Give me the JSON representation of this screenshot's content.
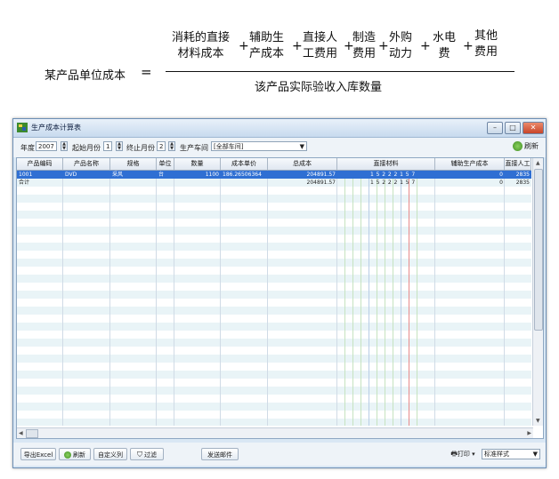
{
  "formula": {
    "lhs": "某产品单位成本",
    "equals": "=",
    "plus": "+",
    "numerator_terms": [
      {
        "line1": "消耗的直接",
        "line2": "材料成本"
      },
      {
        "line1": "辅助生",
        "line2": "产成本"
      },
      {
        "line1": "直接人",
        "line2": "工费用"
      },
      {
        "line1": "制造",
        "line2": "费用"
      },
      {
        "line1": "外购",
        "line2": "动力"
      },
      {
        "line1": "水电",
        "line2": "费"
      },
      {
        "line1": "其他",
        "line2": "费用"
      }
    ],
    "denominator": "该产品实际验收入库数量"
  },
  "window": {
    "title": "生产成本计算表",
    "controls": {
      "minimize": "–",
      "maximize": "□",
      "close": "✕"
    }
  },
  "toolbar": {
    "year_label": "年度",
    "year_value": "2007",
    "start_month_label": "起始月份",
    "start_month_value": "1",
    "end_month_label": "终止月份",
    "end_month_value": "2",
    "workshop_label": "生产车间",
    "workshop_value": "[全部车间]",
    "refresh_label": "刷新"
  },
  "grid": {
    "columns": [
      "产品编码",
      "产品名称",
      "规格",
      "单位",
      "数量",
      "成本单价",
      "总成本",
      "直接材料",
      "辅助生产成本",
      "直接人工"
    ],
    "rows": [
      {
        "selected": true,
        "cells": [
          "1001",
          "DVD",
          "采风",
          "台",
          "1100",
          "186.26506364",
          "204891.57",
          "15222157",
          "0",
          "2835"
        ]
      },
      {
        "selected": false,
        "cells": [
          "合计",
          "",
          "",
          "",
          "",
          "",
          "204891.57",
          "15222157",
          "0",
          "2835"
        ]
      }
    ]
  },
  "bottombar": {
    "export_label": "导出Excel",
    "refresh_label": "刷新",
    "customize_label": "自定义列",
    "filter_label": "过滤",
    "send_mail_label": "发送邮件",
    "print_label": "打印",
    "style_value": "标准样式"
  },
  "colors": {
    "selection": "#2f6fd3",
    "titlebar": "#c7daee",
    "row_alt": "#e9f4f7"
  }
}
